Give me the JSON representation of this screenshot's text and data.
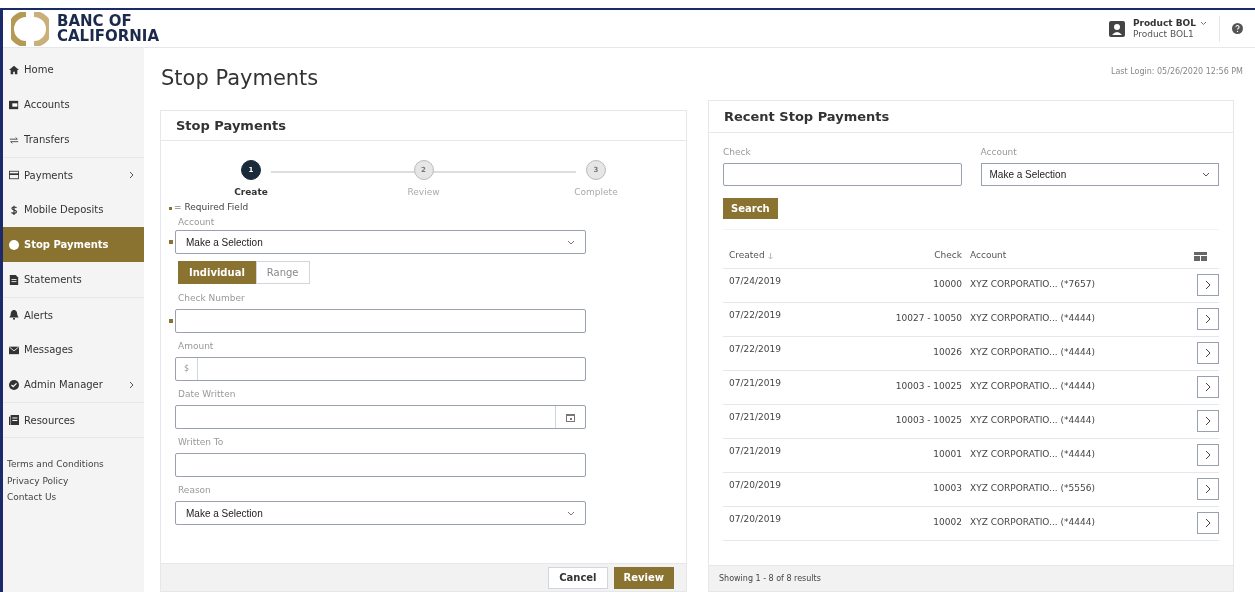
{
  "header": {
    "logo_line_1": "BANC OF",
    "logo_line_2": "CALIFORNIA",
    "user_name": "Product BOL",
    "user_sub": "Product BOL1"
  },
  "sidebar": {
    "items": [
      {
        "label": "Home",
        "selected": false,
        "has_submenu": false
      },
      {
        "label": "Accounts",
        "selected": false,
        "has_submenu": false
      },
      {
        "label": "Transfers",
        "selected": false,
        "has_submenu": false
      },
      {
        "label": "Payments",
        "selected": false,
        "has_submenu": true
      },
      {
        "label": "Mobile Deposits",
        "selected": false,
        "has_submenu": false
      },
      {
        "label": "Stop Payments",
        "selected": true,
        "has_submenu": false
      },
      {
        "label": "Statements",
        "selected": false,
        "has_submenu": false
      },
      {
        "label": "Alerts",
        "selected": false,
        "has_submenu": false
      },
      {
        "label": "Messages",
        "selected": false,
        "has_submenu": false
      },
      {
        "label": "Admin Manager",
        "selected": false,
        "has_submenu": true
      },
      {
        "label": "Resources",
        "selected": false,
        "has_submenu": false
      }
    ],
    "links": [
      "Terms and Conditions",
      "Privacy Policy",
      "Contact Us"
    ]
  },
  "page_title": "Stop Payments",
  "last_login": "Last Login: 05/26/2020 12:56 PM",
  "form_card": {
    "title": "Stop Payments",
    "steps": [
      {
        "number": "1",
        "label": "Create",
        "selected": true
      },
      {
        "number": "2",
        "label": "Review",
        "selected": false
      },
      {
        "number": "3",
        "label": "Complete",
        "selected": false
      }
    ],
    "required_note": "= Required Field",
    "account": {
      "label": "Account",
      "value": "Make a Selection",
      "required": true
    },
    "mode_toggle": [
      {
        "label": "Individual",
        "selected": true
      },
      {
        "label": "Range",
        "selected": false
      }
    ],
    "fields": [
      {
        "kind": "text",
        "label": "Check Number",
        "required": true
      },
      {
        "kind": "money",
        "label": "Amount",
        "prefix": "$",
        "required": false
      },
      {
        "kind": "date",
        "label": "Date Written",
        "required": false
      },
      {
        "kind": "text",
        "label": "Written To",
        "required": false
      },
      {
        "kind": "select",
        "label": "Reason",
        "value": "Make a Selection",
        "required": false
      }
    ],
    "buttons": [
      {
        "label": "Cancel",
        "kind": "secondary"
      },
      {
        "label": "Review",
        "kind": "primary"
      }
    ]
  },
  "recent_card": {
    "title": "Recent Stop Payments",
    "check_label": "Check",
    "account_label": "Account",
    "account_value": "Make a Selection",
    "search_button": "Search",
    "columns": [
      "Created",
      "Check",
      "Account"
    ],
    "rows": [
      {
        "created": "07/24/2019",
        "check": "10000",
        "account": "XYZ CORPORATIO... (*7657)"
      },
      {
        "created": "07/22/2019",
        "check": "10027 - 10050",
        "account": "XYZ CORPORATIO... (*4444)"
      },
      {
        "created": "07/22/2019",
        "check": "10026",
        "account": "XYZ CORPORATIO... (*4444)"
      },
      {
        "created": "07/21/2019",
        "check": "10003 - 10025",
        "account": "XYZ CORPORATIO... (*4444)"
      },
      {
        "created": "07/21/2019",
        "check": "10003 - 10025",
        "account": "XYZ CORPORATIO... (*4444)"
      },
      {
        "created": "07/21/2019",
        "check": "10001",
        "account": "XYZ CORPORATIO... (*4444)"
      },
      {
        "created": "07/20/2019",
        "check": "10003",
        "account": "XYZ CORPORATIO... (*5556)"
      },
      {
        "created": "07/20/2019",
        "check": "10002",
        "account": "XYZ CORPORATIO... (*4444)"
      }
    ],
    "footer": "Showing 1 - 8 of 8 results"
  }
}
